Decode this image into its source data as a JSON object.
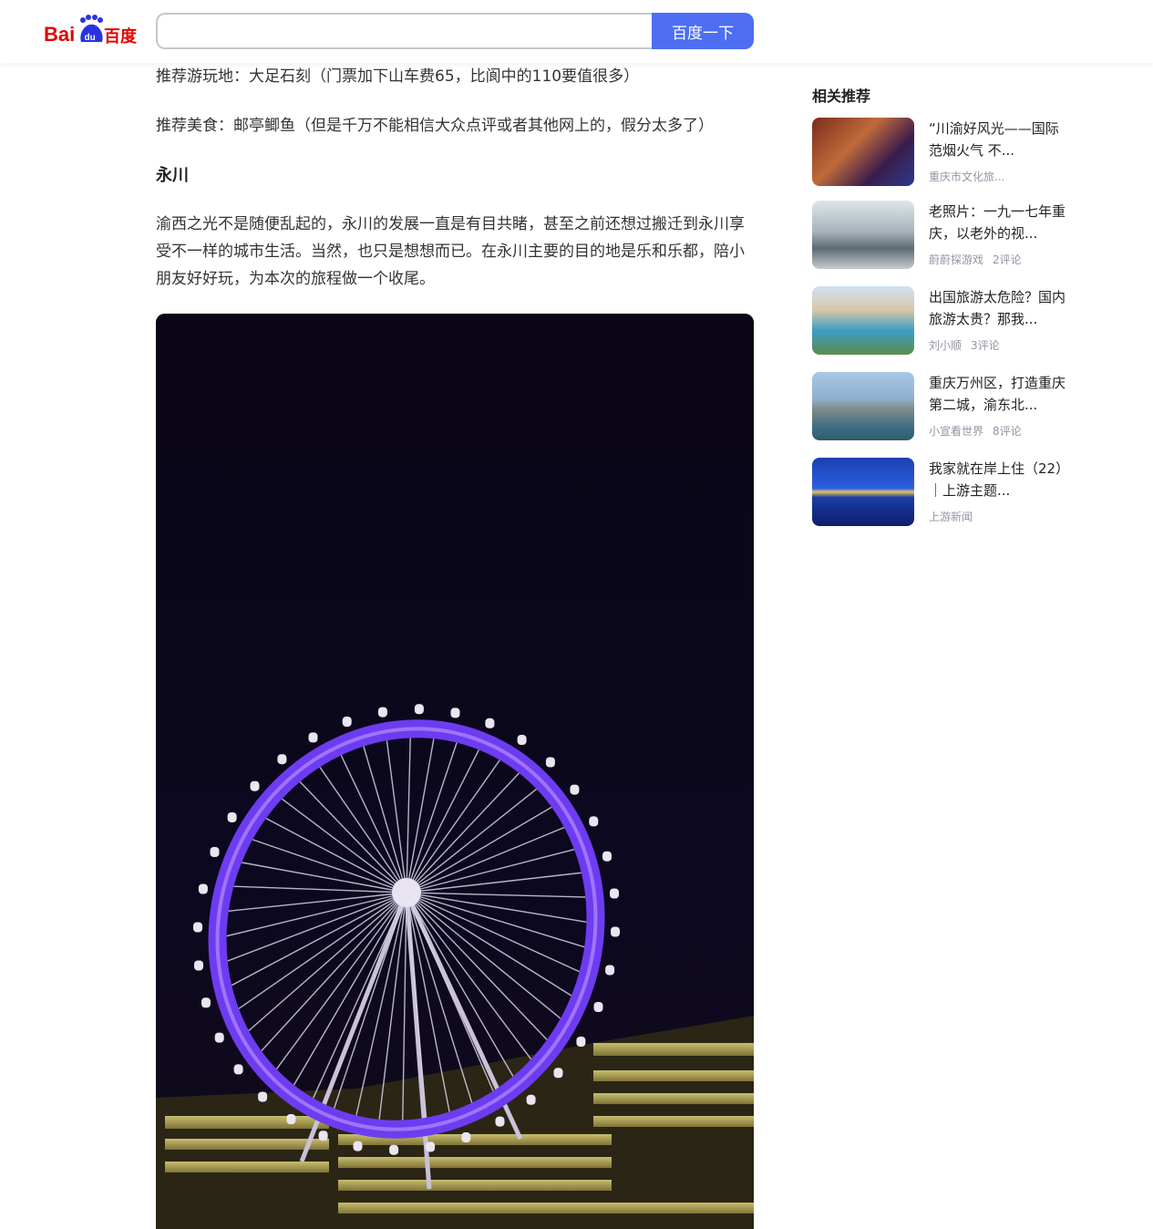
{
  "header": {
    "logo_text": "Bai du 百度",
    "search_placeholder": "",
    "search_button": "百度一下"
  },
  "article": {
    "para1": "推荐游玩地：大足石刻（门票加下山车费65，比阆中的110要值很多）",
    "para2": "推荐美食：邮亭鲫鱼（但是千万不能相信大众点评或者其他网上的，假分太多了）",
    "heading": "永川",
    "para3": "渝西之光不是随便乱起的，永川的发展一直是有目共睹，甚至之前还想过搬迁到永川享受不一样的城市生活。当然，也只是想想而已。在永川主要的目的地是乐和乐都，陪小朋友好好玩，为本次的旅程做一个收尾。"
  },
  "sidebar": {
    "title": "相关推荐",
    "items": [
      {
        "title": "“川渝好风光——国际范烟火气 不...",
        "source": "重庆市文化旅...",
        "comments": ""
      },
      {
        "title": "老照片：一九一七年重庆，以老外的视...",
        "source": "蔚蔚探游戏",
        "comments": "2评论"
      },
      {
        "title": "出国旅游太危险？国内旅游太贵？那我...",
        "source": "刘小顺",
        "comments": "3评论"
      },
      {
        "title": "重庆万州区，打造重庆第二城，渝东北...",
        "source": "小宣看世界",
        "comments": "8评论"
      },
      {
        "title": "我家就在岸上住（22）｜上游主题...",
        "source": "上游新闻",
        "comments": ""
      }
    ]
  },
  "colors": {
    "brand_blue": "#4e6ef2",
    "logo_red": "#e10602",
    "logo_blue": "#2932e1",
    "meta_gray": "#9195a3"
  }
}
